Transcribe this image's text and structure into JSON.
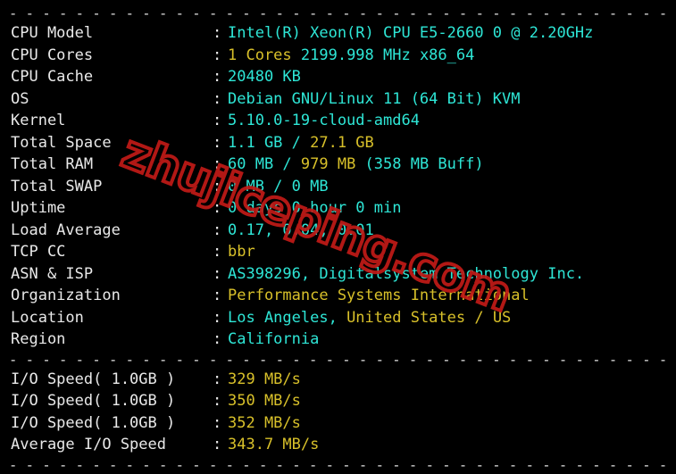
{
  "terminal": {
    "divider_top": "- - - - - - - - - - - - - - - - - - - - - - - - - - - - - - - - - - - - - - - - - - - - - - - - - -",
    "divider_mid": "- - - - - - - - - - - - - - - - - - - - - - - - - - - - - - - - - - - - - - - - - - - - - - - - - -",
    "divider_bottom": "- - - - - - - - - - - - - - - - - - - - - - - - - - - - - - - - - - - - - - - - - - - - - - - - - -",
    "colon": ":",
    "colors": {
      "background": "#000000",
      "label": "#e9e9e9",
      "cyan": "#2ee6d6",
      "yellow": "#d8c02a",
      "watermark": "#c21b17"
    },
    "system_rows": [
      {
        "label": "CPU Model",
        "segments": [
          {
            "text": "Intel(R) Xeon(R) CPU E5-2660 0 @ 2.20GHz",
            "color": "cyan"
          }
        ]
      },
      {
        "label": "CPU Cores",
        "segments": [
          {
            "text": "1 Cores",
            "color": "yellow"
          },
          {
            "text": " 2199.998 MHz x86_64",
            "color": "cyan"
          }
        ]
      },
      {
        "label": "CPU Cache",
        "segments": [
          {
            "text": "20480 KB",
            "color": "cyan"
          }
        ]
      },
      {
        "label": "OS",
        "segments": [
          {
            "text": "Debian GNU/Linux 11 (64 Bit) KVM",
            "color": "cyan"
          }
        ]
      },
      {
        "label": "Kernel",
        "segments": [
          {
            "text": "5.10.0-19-cloud-amd64",
            "color": "cyan"
          }
        ]
      },
      {
        "label": "Total Space",
        "segments": [
          {
            "text": "1.1 GB / ",
            "color": "cyan"
          },
          {
            "text": "27.1 GB",
            "color": "yellow"
          }
        ]
      },
      {
        "label": "Total RAM",
        "segments": [
          {
            "text": "60 MB / ",
            "color": "cyan"
          },
          {
            "text": "979 MB",
            "color": "yellow"
          },
          {
            "text": " (358 MB Buff)",
            "color": "cyan"
          }
        ]
      },
      {
        "label": "Total SWAP",
        "segments": [
          {
            "text": "0 MB / 0 MB",
            "color": "cyan"
          }
        ]
      },
      {
        "label": "Uptime",
        "segments": [
          {
            "text": "0 days 0 hour 0 min",
            "color": "cyan"
          }
        ]
      },
      {
        "label": "Load Average",
        "segments": [
          {
            "text": "0.17, 0.04, 0.01",
            "color": "cyan"
          }
        ]
      },
      {
        "label": "TCP CC",
        "segments": [
          {
            "text": "bbr",
            "color": "yellow"
          }
        ]
      },
      {
        "label": "ASN & ISP",
        "segments": [
          {
            "text": "AS398296, Digitalsystem Technology Inc.",
            "color": "cyan"
          }
        ]
      },
      {
        "label": "Organization",
        "segments": [
          {
            "text": "Performance Systems International",
            "color": "yellow"
          }
        ]
      },
      {
        "label": "Location",
        "segments": [
          {
            "text": "Los Angeles, ",
            "color": "cyan"
          },
          {
            "text": "United States / US",
            "color": "yellow"
          }
        ]
      },
      {
        "label": "Region",
        "segments": [
          {
            "text": "California",
            "color": "cyan"
          }
        ]
      }
    ],
    "io_rows": [
      {
        "label": "I/O Speed( 1.0GB )",
        "segments": [
          {
            "text": "329 MB/s",
            "color": "yellow"
          }
        ]
      },
      {
        "label": "I/O Speed( 1.0GB )",
        "segments": [
          {
            "text": "350 MB/s",
            "color": "yellow"
          }
        ]
      },
      {
        "label": "I/O Speed( 1.0GB )",
        "segments": [
          {
            "text": "352 MB/s",
            "color": "yellow"
          }
        ]
      },
      {
        "label": "Average I/O Speed",
        "segments": [
          {
            "text": "343.7 MB/s",
            "color": "yellow"
          }
        ]
      }
    ]
  },
  "watermark": {
    "text": "zhujiceping.com"
  }
}
